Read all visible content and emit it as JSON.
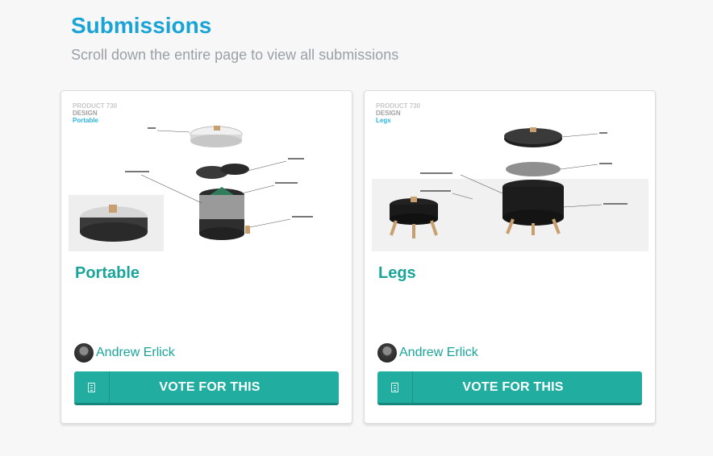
{
  "header": {
    "title": "Submissions",
    "subtitle": "Scroll down the entire page to view all submissions"
  },
  "submissions": [
    {
      "image_label": {
        "line1": "PRODUCT 730",
        "line2": "DESIGN",
        "line3": "Portable"
      },
      "title": "Portable",
      "author": "Andrew Erlick",
      "vote_label": "VOTE FOR THIS"
    },
    {
      "image_label": {
        "line1": "PRODUCT 730",
        "line2": "DESIGN",
        "line3": "Legs"
      },
      "title": "Legs",
      "author": "Andrew Erlick",
      "vote_label": "VOTE FOR THIS"
    }
  ],
  "colors": {
    "title": "#1aa3d6",
    "accent": "#1aa59a",
    "button": "#21ad9f"
  },
  "icons": {
    "vote": "ballot-icon"
  }
}
